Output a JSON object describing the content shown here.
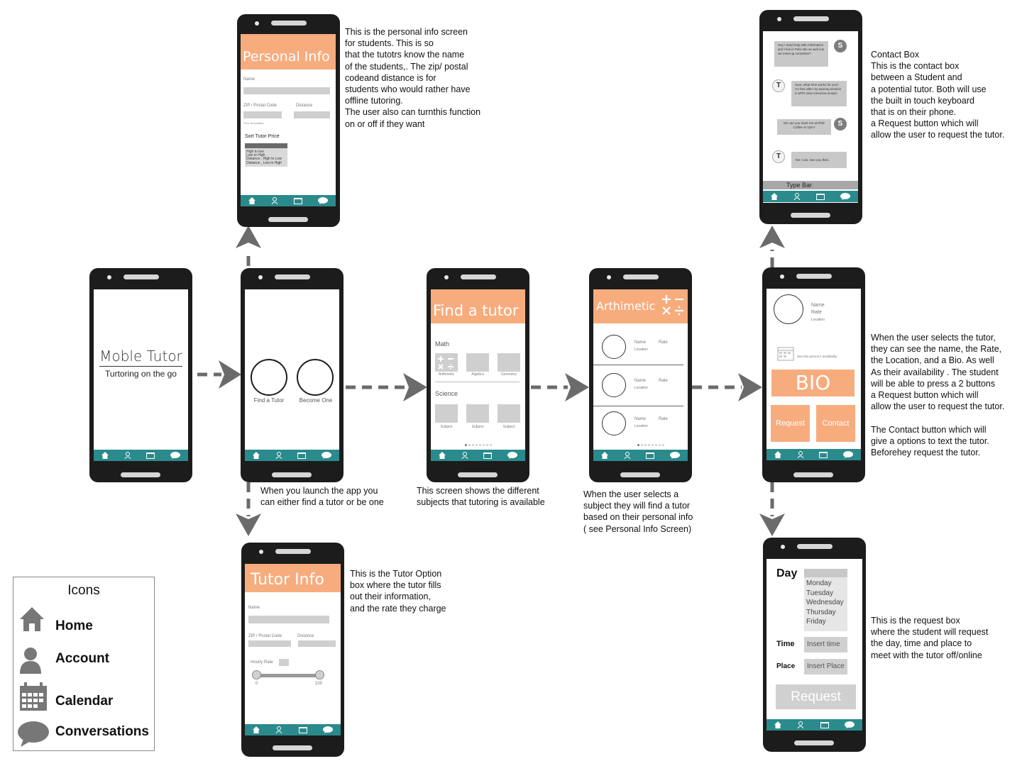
{
  "splash": {
    "title": "Moble Tutor",
    "subtitle": "Turtoring on the go"
  },
  "home": {
    "find_label": "Find a Tutor",
    "become_label": "Become One"
  },
  "personal_info": {
    "header": "Personal Info",
    "name_label": "Name",
    "zip_label": "ZIP / Postal  Code",
    "distance_label": "Distance",
    "toggle_label": "Turn off location",
    "sort_label": "Sort Tutor Price",
    "sort_options": [
      "High to low",
      "Low to High",
      "Distance , High to Low",
      "Distance , Low to High"
    ]
  },
  "find_tutor": {
    "header": "Find a tutor",
    "math_label": "Math",
    "math_items": [
      "Arithmetic",
      "Algebra",
      "Geometry"
    ],
    "science_label": "Science",
    "science_items": [
      "Subject",
      "Subject",
      "Subject"
    ]
  },
  "arithmetic": {
    "header": "Arthimetic",
    "rows": [
      {
        "name": "Name",
        "rate": "Rate",
        "location": "Location"
      },
      {
        "name": "Name",
        "rate": "Rate",
        "location": "Location"
      },
      {
        "name": "Name",
        "rate": "Rate",
        "location": "Location"
      }
    ]
  },
  "profile": {
    "name": "Name",
    "rate": "Rate",
    "location": "Location",
    "availability": "See this person's availability",
    "bio": "BIO",
    "request": "Request",
    "contact": "Contact"
  },
  "chat": {
    "messages": [
      {
        "from": "S",
        "text": "Hey I need help with Arithmetics and I live in Palo Alto as well can we meet up sometime?"
      },
      {
        "from": "T",
        "text": "Sure, what time works for you? I'm free after my tutoring session in MTN view tomorrow at 6pm"
      },
      {
        "from": "S",
        "text": "OK can you meet me at Philz Coffee at 7pm?"
      },
      {
        "from": "T",
        "text": "Yes I can. See you then."
      }
    ],
    "type_bar": "Type Bar"
  },
  "tutor_info": {
    "header": "Tutor Info",
    "name_label": "Name",
    "zip_label": "ZIP / Postal  Code",
    "distance_label": "Distance",
    "rate_label": "Hourly Rate",
    "slider_min": "0",
    "slider_max": "100"
  },
  "request_box": {
    "day_label": "Day",
    "days": [
      "Monday",
      "Tuesday",
      "Wednesday",
      "Thursday",
      "Friday"
    ],
    "time_label": "Time",
    "time_placeholder": "Insert time",
    "place_label": "Place",
    "place_placeholder": "Insert Place",
    "request_button": "Request"
  },
  "notes": {
    "personal_info": "This is the personal info screen\nfor students. This is so\nthat the tutotrs know the name\nof the students,. The zip/ postal\ncodeand distance is for\nstudents who would rather have\noffline tutoring.\nThe user also can turnthis function\non or off if they want",
    "contact_box": "Contact Box\nThis is the contact box\nbetween a Student and\na potential tutor. Both will use\nthe built in touch keyboard\nthat is on their phone.\na Request button which will\nallow the user to request the tutor.",
    "launch": "When you launch the app you\ncan either find a tutor or  be one",
    "subjects": "This screen shows the different\nsubjects that tutoring is available",
    "select_subject": "When the user selects a\nsubject they will find a tutor\nbased on their personal info\n( see Personal Info Screen)",
    "select_tutor": "When the user selects the tutor,\nthey can see the name, the Rate,\nthe Location, and a Bio. As well\nAs their availability . The student\nwill be able to press a 2 buttons\na Request button which will\nallow the user to request the tutor.\n\nThe  Contact button which will\ngive a options to text the tutor.\nBeforehey request the tutor.",
    "tutor_option": "This is the Tutor Option\nbox where the tutor fills\nout their information,\nand the rate they charge",
    "request_box": "This is the request box\nwhere the student will request\nthe day, time and place to\nmeet with the tutor off/online"
  },
  "legend": {
    "title": "Icons",
    "items": [
      {
        "icon": "home-icon",
        "label": "Home"
      },
      {
        "icon": "account-icon",
        "label": "Account"
      },
      {
        "icon": "calendar-icon",
        "label": "Calendar"
      },
      {
        "icon": "conversations-icon",
        "label": "Conversations"
      }
    ]
  },
  "colors": {
    "accent": "#f7ac7e",
    "navbar": "#2a8a8c",
    "phone": "#1c1c1c",
    "placeholder": "#cfcfcf",
    "arrow": "#6b6b6b"
  }
}
